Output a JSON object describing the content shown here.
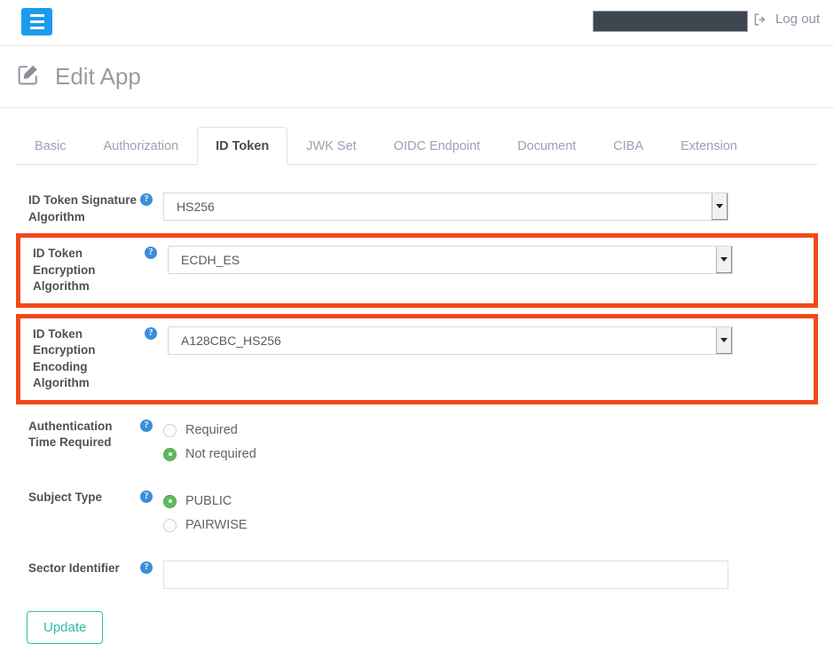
{
  "topbar": {
    "menu_icon": "hamburger-icon",
    "redacted_field": "",
    "logout_label": "Log out",
    "logout_icon": "sign-out-icon",
    "accent_blue": "#1b9bf0",
    "redact_color": "#3e4650"
  },
  "header": {
    "title": "Edit App",
    "icon": "edit-square-icon"
  },
  "tabs": [
    {
      "label": "Basic",
      "active": false
    },
    {
      "label": "Authorization",
      "active": false
    },
    {
      "label": "ID Token",
      "active": true
    },
    {
      "label": "JWK Set",
      "active": false
    },
    {
      "label": "OIDC Endpoint",
      "active": false
    },
    {
      "label": "Document",
      "active": false
    },
    {
      "label": "CIBA",
      "active": false
    },
    {
      "label": "Extension",
      "active": false
    }
  ],
  "form": {
    "help_glyph": "?",
    "highlight_color": "#f1491a",
    "fields": {
      "signature_algorithm": {
        "label": "ID Token Signature Algorithm",
        "value": "HS256"
      },
      "encryption_algorithm": {
        "label": "ID Token Encryption Algorithm",
        "value": "ECDH_ES"
      },
      "encryption_encoding_algorithm": {
        "label": "ID Token Encryption Encoding Algorithm",
        "value": "A128CBC_HS256"
      },
      "auth_time_required": {
        "label": "Authentication Time Required",
        "options": [
          {
            "label": "Required",
            "selected": false
          },
          {
            "label": "Not required",
            "selected": true
          }
        ]
      },
      "subject_type": {
        "label": "Subject Type",
        "options": [
          {
            "label": "PUBLIC",
            "selected": true
          },
          {
            "label": "PAIRWISE",
            "selected": false
          }
        ]
      },
      "sector_identifier": {
        "label": "Sector Identifier",
        "value": "",
        "placeholder": ""
      }
    },
    "submit_label": "Update"
  }
}
